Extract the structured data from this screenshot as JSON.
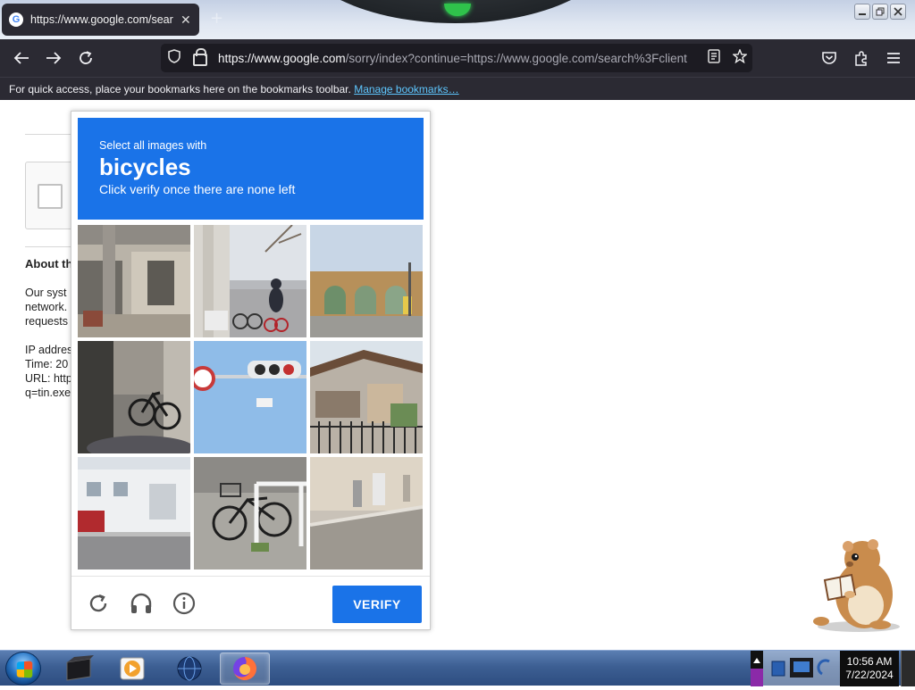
{
  "browser": {
    "tab_title": "https://www.google.com/search",
    "tab_close": "✕",
    "new_tab": "+",
    "url_host": "https://www.google.com",
    "url_rest": "/sorry/index?continue=https://www.google.com/search%3Fclient",
    "bookmarks_message": "For quick access, place your bookmarks here on the bookmarks toolbar.",
    "bookmarks_link": "Manage bookmarks…"
  },
  "background_page": {
    "about_heading": "About th",
    "para_lines": [
      "Our syst",
      "network.",
      "requests"
    ],
    "ip_line": "IP addres",
    "time_line": "Time: 20",
    "url_line": "URL: http",
    "q_line": "q=tin.exe"
  },
  "captcha": {
    "instruction_line1": "Select all images with",
    "target_object": "bicycles",
    "instruction_line3": "Click verify once there are none left",
    "verify_label": "VERIFY",
    "tiles": [
      "tile-storefront-pole",
      "tile-cyclist-street",
      "tile-arch-gate",
      "tile-bikes-parked",
      "tile-traffic-light",
      "tile-house-fence",
      "tile-white-house",
      "tile-bike-rack",
      "tile-sidewalk-post"
    ]
  },
  "taskbar": {
    "time": "10:56 AM",
    "date": "7/22/2024"
  },
  "colors": {
    "captcha_blue": "#1a73e8",
    "browser_dark": "#2b2a33",
    "link_blue": "#5ec7ff"
  }
}
